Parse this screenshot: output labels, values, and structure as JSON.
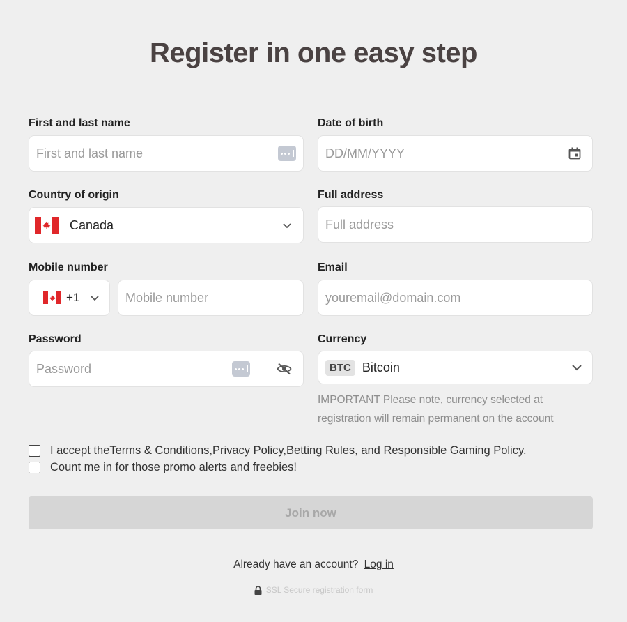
{
  "title": "Register in one easy step",
  "fields": {
    "name": {
      "label": "First and last name",
      "placeholder": "First and last name"
    },
    "dob": {
      "label": "Date of birth",
      "placeholder": "DD/MM/YYYY"
    },
    "country": {
      "label": "Country of origin",
      "value": "Canada"
    },
    "address": {
      "label": "Full address",
      "placeholder": "Full address"
    },
    "mobile": {
      "label": "Mobile number",
      "code": "+1",
      "placeholder": "Mobile number"
    },
    "email": {
      "label": "Email",
      "placeholder": "youremail@domain.com"
    },
    "password": {
      "label": "Password",
      "placeholder": "Password"
    },
    "currency": {
      "label": "Currency",
      "code": "BTC",
      "value": "Bitcoin"
    }
  },
  "currency_note": "IMPORTANT Please note, currency selected at registration will remain permanent on the account",
  "terms": {
    "prefix": "I accept the",
    "terms_link": " Terms & Conditions,",
    "privacy_link": " Privacy Policy,",
    "betting_link": " Betting Rules",
    "and_text": ", and ",
    "rg_link": "Responsible Gaming Policy."
  },
  "promo_label": "Count me in for those promo alerts and freebies!",
  "join_label": "Join now",
  "already_text": "Already have an account?",
  "login_link": "Log in",
  "ssl_text": "SSL Secure registration form",
  "colors": {
    "flag_red": "#e0272a",
    "background": "#efefef"
  }
}
